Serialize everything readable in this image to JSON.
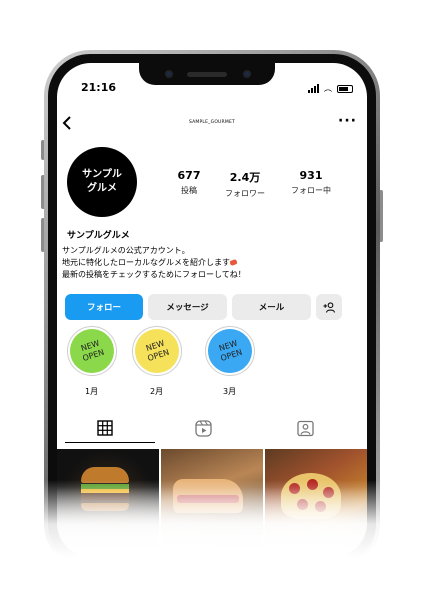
{
  "status_bar": {
    "time": "21:16"
  },
  "header": {
    "username": "SAMPLE_GOURMET",
    "back_icon": "chevron-left-icon",
    "more_icon": "more-horizontal-icon"
  },
  "profile": {
    "avatar_text": "サンプル\nグルメ",
    "display_name": "サンプルグルメ",
    "stats": [
      {
        "value": "677",
        "label": "投稿"
      },
      {
        "value": "2.4万",
        "label": "フォロワー"
      },
      {
        "value": "931",
        "label": "フォロー中"
      }
    ],
    "bio": [
      "サンプルグルメの公式アカウント。",
      "地元に特化したローカルなグルメを紹介します",
      "最新の投稿をチェックするためにフォローしてね！"
    ]
  },
  "actions": {
    "follow": "フォロー",
    "message": "メッセージ",
    "mail": "メール",
    "add_user_icon": "add-user-icon"
  },
  "highlights": [
    {
      "text": "NEW\nOPEN",
      "label": "1月",
      "color": "#8bd94a"
    },
    {
      "text": "NEW\nOPEN",
      "label": "2月",
      "color": "#f5e15a"
    },
    {
      "text": "NEW\nOPEN",
      "label": "3月",
      "color": "#3aa8f2"
    }
  ],
  "tabs": [
    {
      "icon": "grid-icon",
      "active": true
    },
    {
      "icon": "reels-icon",
      "active": false
    },
    {
      "icon": "tagged-user-icon",
      "active": false
    }
  ],
  "colors": {
    "follow_button": "#1a9bf2",
    "secondary_button": "#ebebeb"
  }
}
